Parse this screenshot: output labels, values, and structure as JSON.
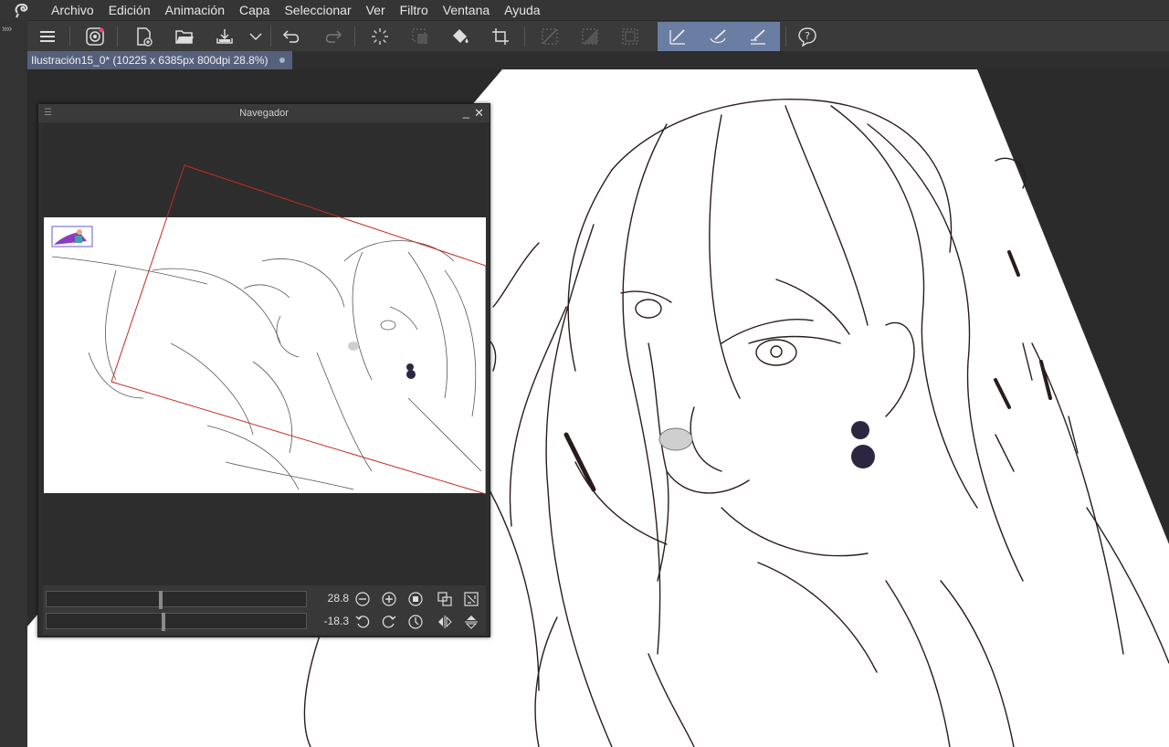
{
  "menubar": {
    "items": [
      "Archivo",
      "Edición",
      "Animación",
      "Capa",
      "Seleccionar",
      "Ver",
      "Filtro",
      "Ventana",
      "Ayuda"
    ]
  },
  "toolbar": {
    "icons": [
      "menu-icon",
      "clip-studio-icon",
      "new-file-icon",
      "open-folder-icon",
      "save-icon",
      "dropdown-icon",
      "undo-icon",
      "redo-icon",
      "loading-icon",
      "selection-icon",
      "fill-icon",
      "crop-icon",
      "deselect-icon",
      "invert-selection-icon",
      "selection-border-icon",
      "stroke-tool-1-icon",
      "stroke-tool-2-icon",
      "stroke-tool-3-icon",
      "help-icon"
    ],
    "accent": "#6a7ea3"
  },
  "document_tab": {
    "label": "Ilustración15_0* (10225 x 6385px 800dpi 28.8%)"
  },
  "navigator": {
    "title": "Navegador",
    "zoom_value": "28.8",
    "rotation_value": "-18.3",
    "zoom_slider_fraction": 0.44,
    "rotation_slider_fraction": 0.45,
    "frame_color": "#c62828"
  }
}
